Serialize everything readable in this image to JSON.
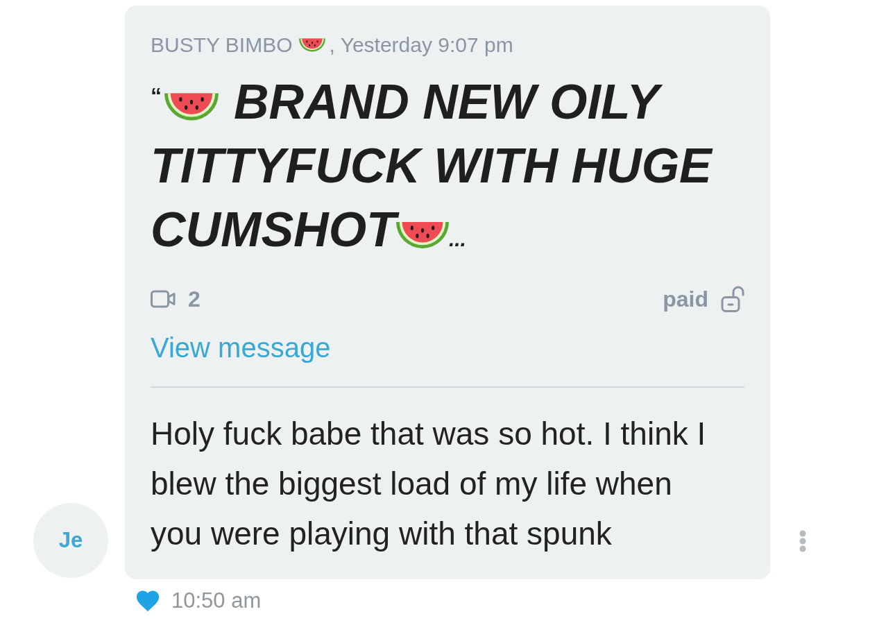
{
  "message": {
    "sender": "BUSTY BIMBO",
    "sent_time": ", Yesterday 9:07 pm",
    "preview": {
      "quote": "“",
      "text": "BRAND NEW OILY TITTYFUCK WITH HUGE CUMSHOT",
      "ellipsis": "..."
    },
    "media": [
      {
        "kind": "video",
        "count": "2"
      }
    ],
    "price_status": "paid",
    "locked": false,
    "link": "View message",
    "body": "Holy fuck babe that was so hot. I think I blew the biggest load of my life when you were playing with that spunk",
    "avatar": {
      "initials": "Je"
    },
    "liked": true,
    "time": "10:50 am"
  }
}
